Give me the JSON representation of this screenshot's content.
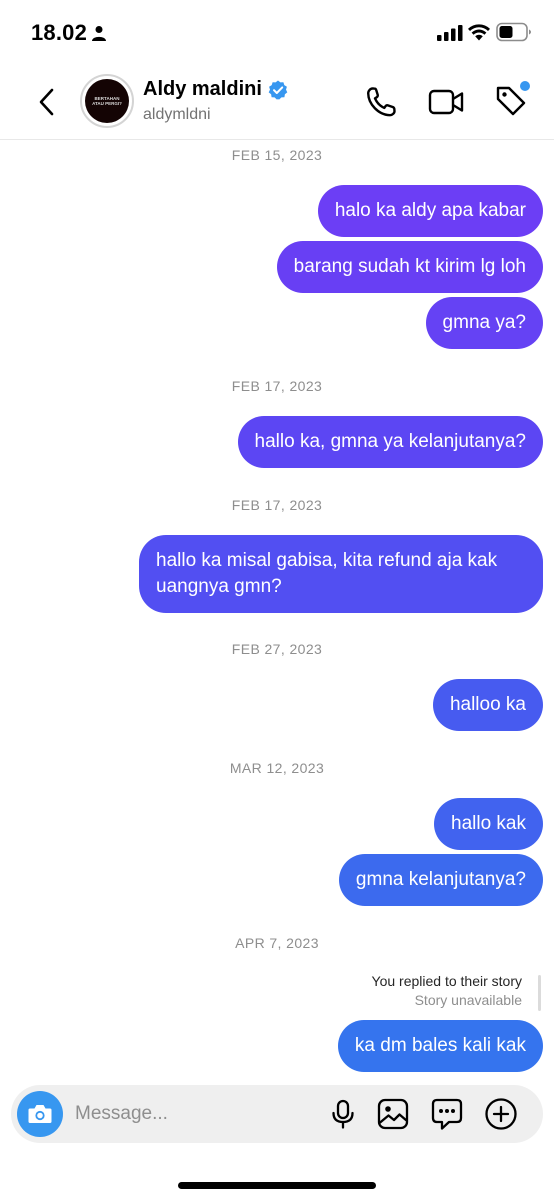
{
  "status": {
    "time": "18.02"
  },
  "header": {
    "contact_name": "Aldy maldini",
    "handle": "aldymldni",
    "avatar_text": "BERTAHAN ATAU PERGI?"
  },
  "chat": {
    "dates": [
      "FEB 15, 2023",
      "FEB 17, 2023",
      "FEB 17, 2023",
      "FEB 27, 2023",
      "MAR 12, 2023",
      "APR 7, 2023"
    ],
    "messages": [
      "halo ka aldy apa kabar",
      "barang sudah kt kirim lg loh",
      "gmna ya?",
      "hallo ka, gmna ya kelanjutanya?",
      "hallo ka misal gabisa, kita refund aja kak uangnya gmn?",
      "halloo ka",
      "hallo kak",
      "gmna kelanjutanya?",
      "ka dm bales kali kak"
    ],
    "bubble_colors": [
      "#6c3ef5",
      "#683ff4",
      "#6542f4",
      "#5c46f3",
      "#524ff2",
      "#475bf0",
      "#4163ef",
      "#3c6aee",
      "#3574ee"
    ],
    "story_reply": {
      "title": "You replied to their story",
      "subtitle": "Story unavailable"
    }
  },
  "composer": {
    "placeholder": "Message..."
  },
  "colors": {
    "accent": "#3797f0",
    "verified": "#3797f0"
  },
  "icons": [
    "back-arrow-icon",
    "verified-badge-icon",
    "phone-icon",
    "video-camera-icon",
    "tag-icon",
    "camera-icon",
    "microphone-icon",
    "gallery-icon",
    "sticker-icon",
    "plus-icon"
  ]
}
